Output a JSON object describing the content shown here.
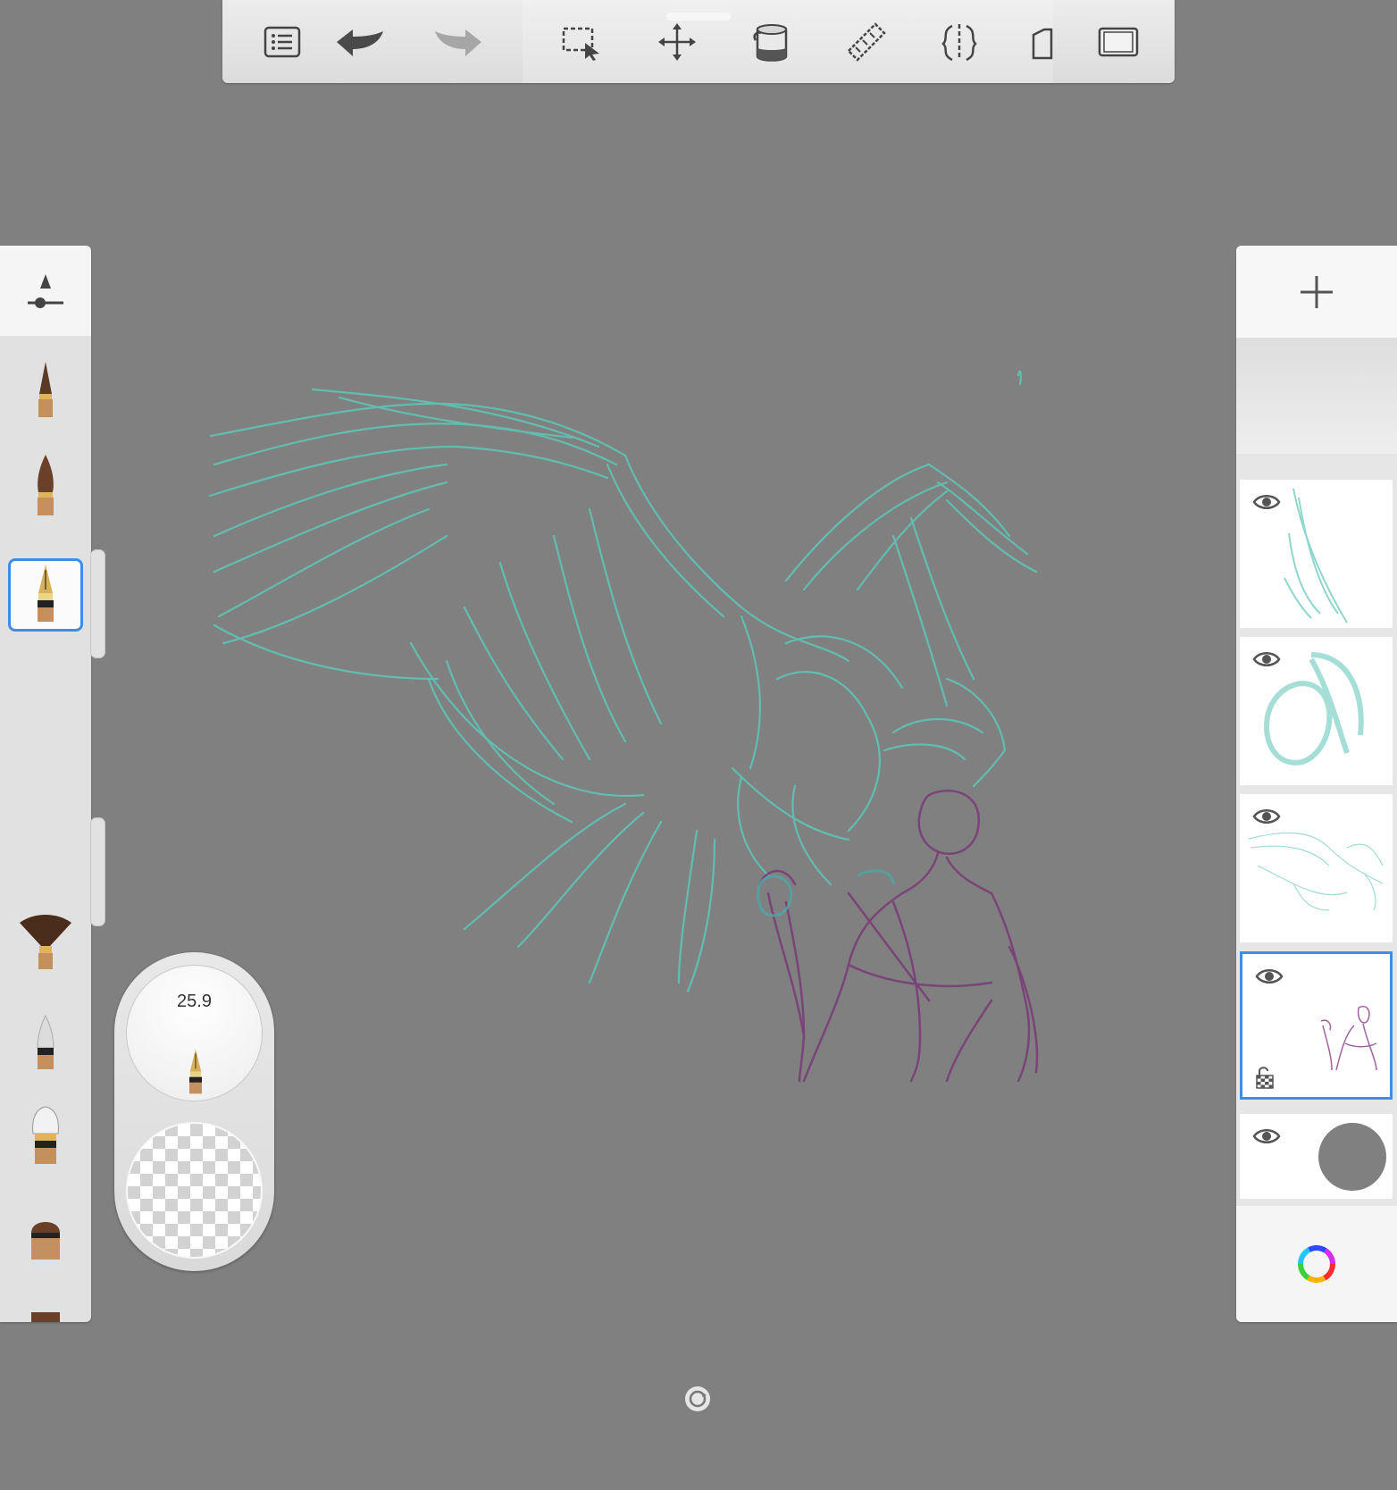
{
  "toolbar": {
    "buttons": [
      {
        "name": "menu-button",
        "icon": "list-icon"
      },
      {
        "name": "undo-button",
        "icon": "undo-arrow-icon"
      },
      {
        "name": "redo-button",
        "icon": "redo-arrow-icon"
      },
      {
        "name": "selection-button",
        "icon": "marquee-select-icon"
      },
      {
        "name": "transform-button",
        "icon": "move-arrows-icon"
      },
      {
        "name": "fill-button",
        "icon": "paint-bucket-icon"
      },
      {
        "name": "ruler-button",
        "icon": "ruler-icon"
      },
      {
        "name": "symmetry-button",
        "icon": "symmetry-icon"
      },
      {
        "name": "shape-button",
        "icon": "shape-icon"
      },
      {
        "name": "fullscreen-button",
        "icon": "fullscreen-frame-icon"
      }
    ]
  },
  "brushes": {
    "settings_icon": "brush-settings-slider-icon",
    "items": [
      "pencil",
      "marker",
      "ink-pen",
      "fan-brush",
      "airbrush",
      "bristle-brush",
      "flat-brush",
      "chisel-brush",
      "smear-brush",
      "texture-brush"
    ],
    "selected": "ink-pen"
  },
  "puck": {
    "size_value": "25.9",
    "opacity_icon": "opacity-checker-icon"
  },
  "layers": {
    "add_icon": "plus-icon",
    "items": [
      {
        "name": "layer-1",
        "visible": true,
        "content": "feather-sketch"
      },
      {
        "name": "layer-2",
        "visible": true,
        "content": "head-sketch"
      },
      {
        "name": "layer-3",
        "visible": true,
        "content": "eagle-sketch"
      },
      {
        "name": "layer-4",
        "visible": true,
        "content": "figure-sketch",
        "active": true,
        "locked_transparency": true
      },
      {
        "name": "background-layer",
        "visible": true,
        "color": "#808080"
      }
    ],
    "color_icon": "color-wheel-icon"
  },
  "colors": {
    "canvas": "#808080",
    "teal_stroke": "#5ec4b6",
    "purple_stroke": "#7a3a78",
    "accent": "#3e8ee8"
  }
}
